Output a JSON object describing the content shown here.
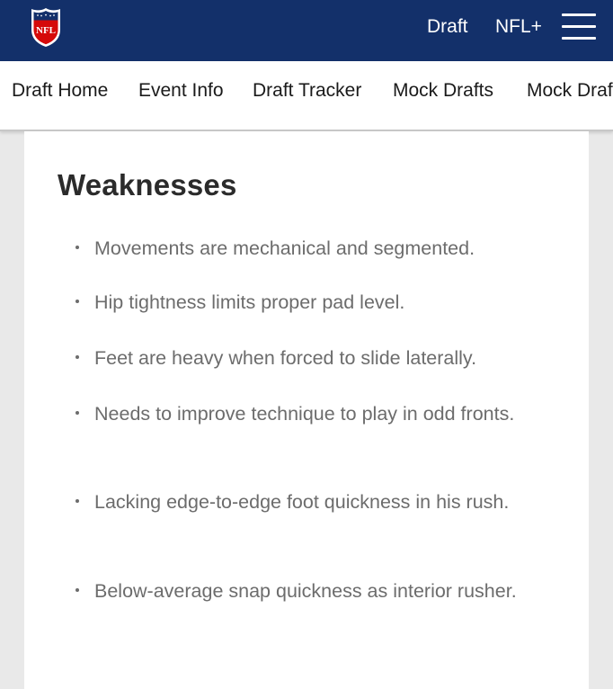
{
  "header": {
    "logo_text": "NFL",
    "links": [
      "Draft",
      "NFL+"
    ]
  },
  "subnav": {
    "items": [
      "Draft Home",
      "Event Info",
      "Draft Tracker",
      "Mock Drafts",
      "Mock Drafts"
    ]
  },
  "content": {
    "heading": "Weaknesses",
    "bullets": [
      "Movements are mechanical and segmented.",
      "Hip tightness limits proper pad level.",
      "Feet are heavy when forced to slide laterally.",
      "Needs to improve technique to play in odd fronts.",
      "Lacking edge-to-edge foot quickness in his rush.",
      "Below-average snap quickness as interior rusher."
    ]
  },
  "colors": {
    "header_bg": "#13306a",
    "nfl_red": "#d50a0a",
    "text_dark": "#1a1a1a",
    "bullet_text": "#6c6c6c"
  },
  "icons": {
    "logo": "nfl-shield-logo",
    "menu": "hamburger-menu-icon"
  }
}
